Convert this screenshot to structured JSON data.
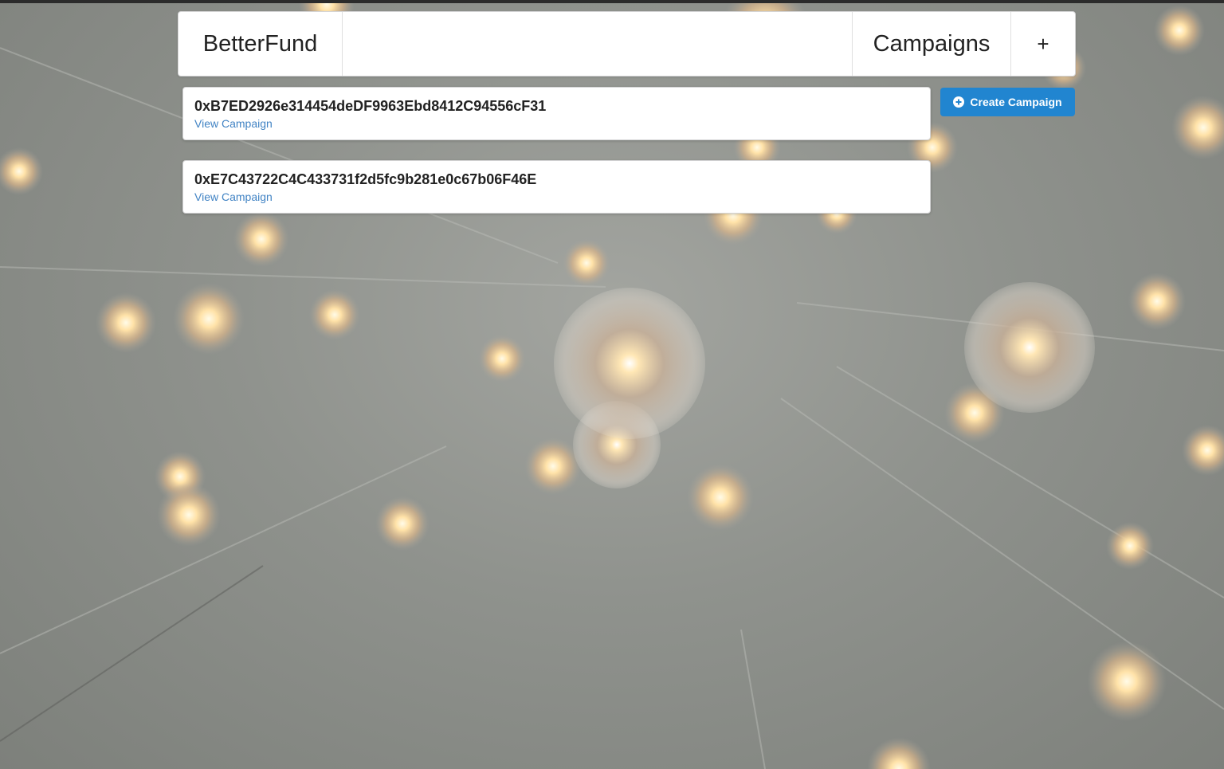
{
  "header": {
    "brand": "BetterFund",
    "campaigns_link": "Campaigns",
    "add_link": "+"
  },
  "campaigns": [
    {
      "address": "0xB7ED2926e314454deDF9963Ebd8412C94556cF31",
      "link_label": "View Campaign"
    },
    {
      "address": "0xE7C43722C4C433731f2d5fc9b281e0c67b06F46E",
      "link_label": "View Campaign"
    }
  ],
  "create_button": {
    "label": "Create Campaign",
    "icon": "add-circle-icon"
  },
  "colors": {
    "primary": "#2185d0",
    "link": "#4183c4"
  }
}
